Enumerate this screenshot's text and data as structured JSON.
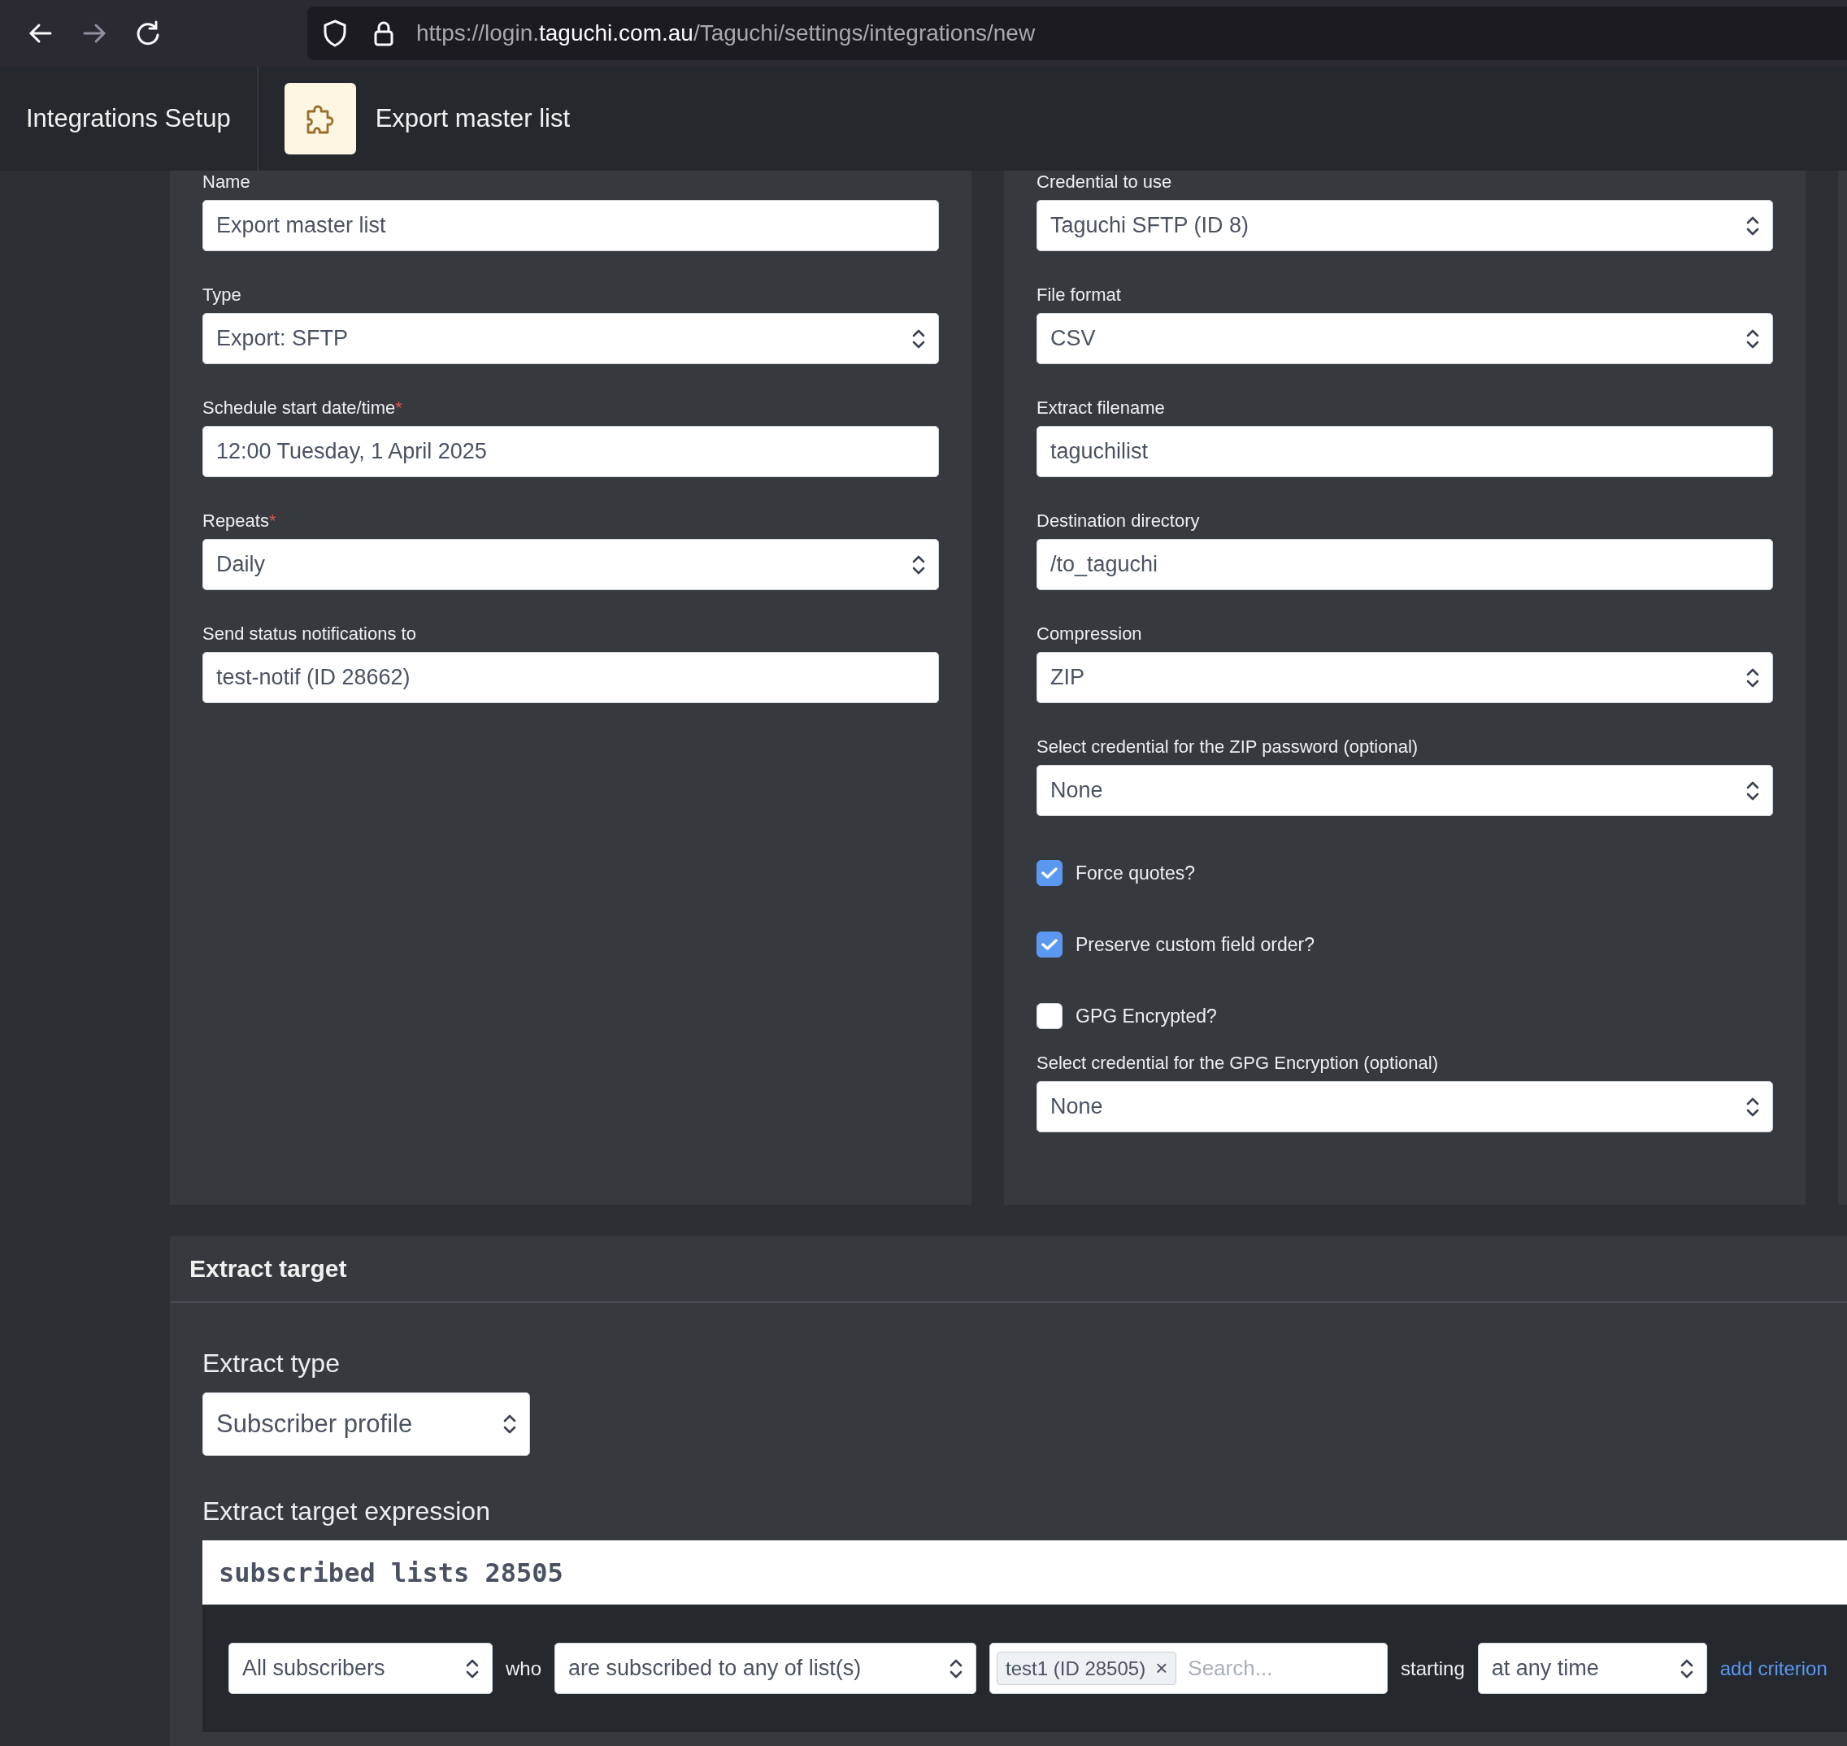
{
  "browser": {
    "url": "https://login.**taguchi.com.au**/Taguchi/settings/integrations/new"
  },
  "header": {
    "section_title": "Integrations Setup",
    "page_title": "Export master list"
  },
  "left_fields": [
    {
      "kind": "text",
      "label": "Name",
      "value": "Export master list"
    },
    {
      "kind": "select",
      "label": "Type",
      "value": "Export: SFTP"
    },
    {
      "kind": "text",
      "label": "Schedule start date/time",
      "required_mark": "*",
      "value": "12:00 Tuesday, 1 April 2025"
    },
    {
      "kind": "select",
      "label": "Repeats",
      "required_mark": "*",
      "value": "Daily"
    },
    {
      "kind": "text",
      "label": "Send status notifications to",
      "value": "test-notif (ID 28662)"
    }
  ],
  "right_fields": [
    {
      "kind": "select",
      "label": "Credential to use",
      "value": "Taguchi SFTP (ID 8)"
    },
    {
      "kind": "select",
      "label": "File format",
      "value": "CSV"
    },
    {
      "kind": "text",
      "label": "Extract filename",
      "value": "taguchilist"
    },
    {
      "kind": "text",
      "label": "Destination directory",
      "value": "/to_taguchi"
    },
    {
      "kind": "select",
      "label": "Compression",
      "value": "ZIP"
    },
    {
      "kind": "select",
      "label": "Select credential for the ZIP password (optional)",
      "value": "None"
    },
    {
      "kind": "checkbox",
      "label": "Force quotes?",
      "checked": true
    },
    {
      "kind": "checkbox",
      "label": "Preserve custom field order?",
      "checked": true
    },
    {
      "kind": "checkbox",
      "label": "GPG Encrypted?",
      "checked": false
    },
    {
      "kind": "select",
      "label": "Select credential for the GPG Encryption (optional)",
      "value": "None"
    }
  ],
  "extract_target": {
    "title": "Extract target",
    "type_label": "Extract type",
    "type_value": "Subscriber profile",
    "expression_label": "Extract target expression",
    "expression": "subscribed lists 28505",
    "criterion": {
      "subject": "All subscribers",
      "who": "who",
      "condition": "are subscribed to any of list(s)",
      "tags": [
        "test1 (ID 28505)"
      ],
      "tag_remove": "×",
      "search_placeholder": "Search...",
      "starting": "starting",
      "time": "at any time",
      "add_link": "add criterion"
    }
  }
}
